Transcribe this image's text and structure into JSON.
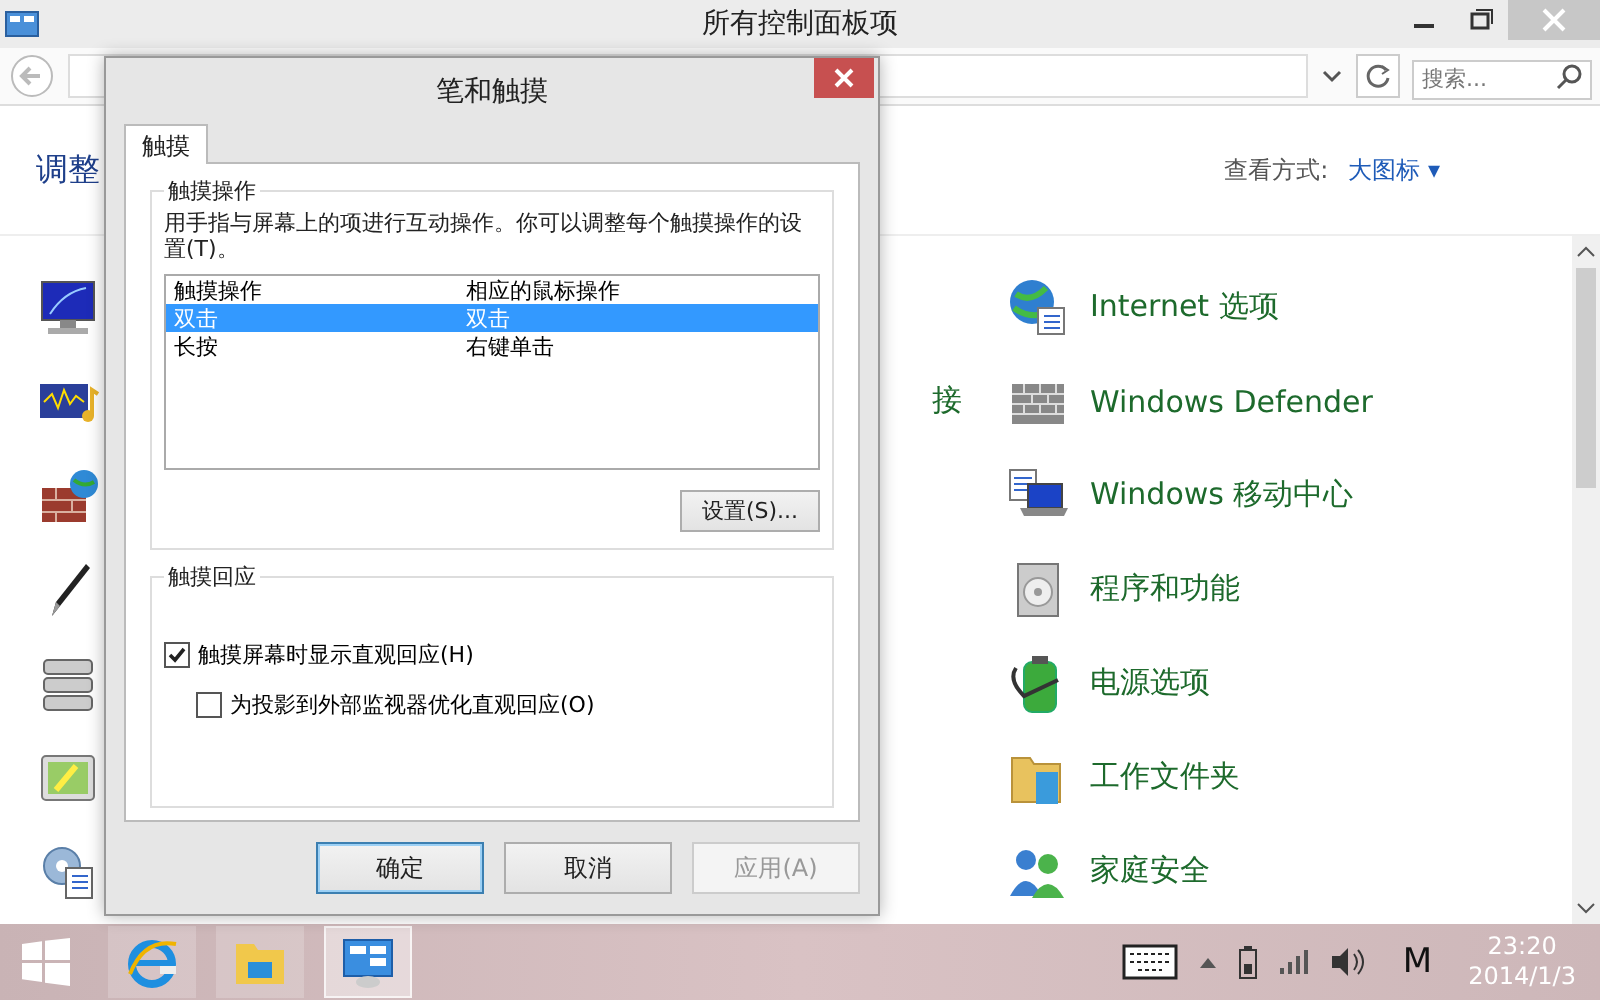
{
  "window": {
    "title": "所有控制面板项"
  },
  "address_bar": {
    "search": {
      "placeholder": "搜索..."
    }
  },
  "header": {
    "title": "调整",
    "view_label": "查看方式:",
    "view_value": "大图标",
    "view_caret": "▾"
  },
  "middle_column": {
    "items": [
      {
        "label": "接"
      }
    ]
  },
  "right_column": {
    "items": [
      {
        "label": "Internet 选项"
      },
      {
        "label": "Windows Defender"
      },
      {
        "label": "Windows 移动中心"
      },
      {
        "label": "程序和功能"
      },
      {
        "label": "电源选项"
      },
      {
        "label": "工作文件夹"
      },
      {
        "label": "家庭安全"
      }
    ]
  },
  "dialog": {
    "title": "笔和触摸",
    "tabs": [
      {
        "label": "触摸",
        "selected": true
      }
    ],
    "touch_actions": {
      "title": "触摸操作",
      "description": "用手指与屏幕上的项进行互动操作。你可以调整每个触摸操作的设置(T)。",
      "columns": [
        "触摸操作",
        "相应的鼠标操作"
      ],
      "rows": [
        {
          "cells": [
            "双击",
            "双击"
          ],
          "selected": true
        },
        {
          "cells": [
            "长按",
            "右键单击"
          ],
          "selected": false
        }
      ],
      "settings_button": "设置(S)..."
    },
    "touch_feedback": {
      "title": "触摸回应",
      "checkboxes": [
        {
          "label": "触摸屏幕时显示直观回应(H)",
          "checked": true,
          "children": [
            {
              "label": "为投影到外部监视器优化直观回应(O)",
              "checked": false
            }
          ]
        }
      ]
    },
    "buttons": [
      {
        "label": "确定",
        "default": true,
        "disabled": false
      },
      {
        "label": "取消",
        "default": false,
        "disabled": false
      },
      {
        "label": "应用(A)",
        "default": false,
        "disabled": true
      }
    ]
  },
  "taskbar": {
    "tray": {
      "ime": "M",
      "time": "23:20",
      "date": "2014/1/3"
    }
  }
}
